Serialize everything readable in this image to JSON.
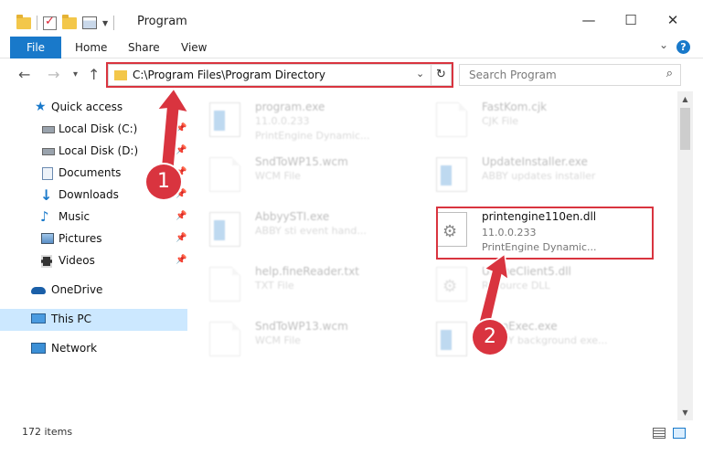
{
  "window": {
    "title": "Program",
    "controls": {
      "minimize": "—",
      "maximize": "☐",
      "close": "✕"
    }
  },
  "ribbon": {
    "file": "File",
    "tabs": [
      "Home",
      "Share",
      "View"
    ],
    "help": "?"
  },
  "nav": {
    "back": "←",
    "forward": "→",
    "recent": "▾",
    "up": "↑",
    "address": "C:\\Program Files\\Program Directory",
    "dropdown": "⌄",
    "refresh": "↻",
    "search_placeholder": "Search Program",
    "search_icon": "⌕"
  },
  "sidebar": {
    "items": [
      {
        "label": "Quick access",
        "icon": "star-icon"
      },
      {
        "label": "Local Disk (C:)",
        "icon": "drive-icon",
        "pinned": true
      },
      {
        "label": "Local Disk (D:)",
        "icon": "drive-icon",
        "pinned": true
      },
      {
        "label": "Documents",
        "icon": "documents-icon",
        "pinned": true
      },
      {
        "label": "Downloads",
        "icon": "downloads-icon",
        "pinned": true
      },
      {
        "label": "Music",
        "icon": "music-icon",
        "pinned": true
      },
      {
        "label": "Pictures",
        "icon": "pictures-icon",
        "pinned": true
      },
      {
        "label": "Videos",
        "icon": "videos-icon",
        "pinned": true
      },
      {
        "label": "OneDrive",
        "icon": "cloud-icon"
      },
      {
        "label": "This PC",
        "icon": "computer-icon",
        "selected": true
      },
      {
        "label": "Network",
        "icon": "network-icon"
      }
    ]
  },
  "files": [
    {
      "name": "program.exe",
      "line2": "11.0.0.233",
      "line3": "PrintEngine Dynamic...",
      "icon": "exe-icon",
      "faded": true
    },
    {
      "name": "FastKom.cjk",
      "line2": "CJK File",
      "line3": "",
      "icon": "doc-icon",
      "faded": true
    },
    {
      "name": "SndToWP15.wcm",
      "line2": "WCM File",
      "line3": "",
      "icon": "doc-icon",
      "faded": true
    },
    {
      "name": "UpdateInstaller.exe",
      "line2": "ABBY updates installer",
      "line3": "",
      "icon": "exe-icon",
      "faded": true
    },
    {
      "name": "AbbyySTI.exe",
      "line2": "ABBY sti event hand...",
      "line3": "",
      "icon": "exe-icon",
      "faded": true
    },
    {
      "name": "printengine110en.dll",
      "line2": "11.0.0.233",
      "line3": "PrintEngine Dynamic...",
      "icon": "gear-doc-icon",
      "faded": false
    },
    {
      "name": "help.fineReader.txt",
      "line2": "TXT File",
      "line3": "",
      "icon": "doc-icon",
      "faded": true
    },
    {
      "name": "UsageClient5.dll",
      "line2": "Resource DLL",
      "line3": "",
      "icon": "gear-doc-icon",
      "faded": true
    },
    {
      "name": "SndToWP13.wcm",
      "line2": "WCM File",
      "line3": "",
      "icon": "doc-icon",
      "faded": true
    },
    {
      "name": "ScanExec.exe",
      "line2": "ABBYY background exe...",
      "line3": "",
      "icon": "exe-icon",
      "faded": true
    }
  ],
  "status": {
    "count": "172 items"
  },
  "annotations": {
    "step1": "1",
    "step2": "2"
  },
  "colors": {
    "accent": "#1979ca",
    "annotation": "#d9343f",
    "selected": "#cce8ff"
  }
}
